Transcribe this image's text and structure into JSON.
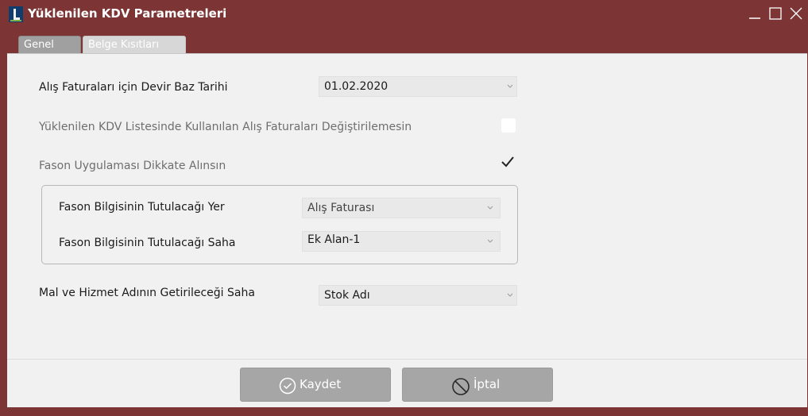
{
  "window": {
    "title": "Yüklenilen KDV Parametreleri",
    "frame_color": "#7c3434",
    "logo_color": "#0f3d6e"
  },
  "tabs": [
    {
      "label": "Genel",
      "active": true
    },
    {
      "label": "Belge Kısıtları",
      "active": false
    }
  ],
  "form": {
    "devir_baz_tarihi": {
      "label": "Alış Faturaları için Devir Baz Tarihi",
      "value": "01.02.2020"
    },
    "degistirilemesin": {
      "label": "Yüklenilen KDV Listesinde Kullanılan Alış Faturaları Değiştirilemesin",
      "checked": false
    },
    "fason_dikkate": {
      "label": "Fason Uygulaması Dikkate Alınsın",
      "checked": true
    },
    "fason_yer": {
      "label": "Fason Bilgisinin Tutulacağı Yer",
      "value": "Alış Faturası"
    },
    "fason_saha": {
      "label": "Fason Bilgisinin Tutulacağı Saha",
      "value": "Ek Alan-1"
    },
    "mal_hizmet_saha": {
      "label": "Mal ve Hizmet Adının Getirileceği Saha",
      "value": "Stok Adı"
    }
  },
  "buttons": {
    "save": {
      "label": "Kaydet",
      "icon": "check-circle-icon"
    },
    "cancel": {
      "label": "İptal",
      "icon": "prohibited-icon"
    }
  }
}
